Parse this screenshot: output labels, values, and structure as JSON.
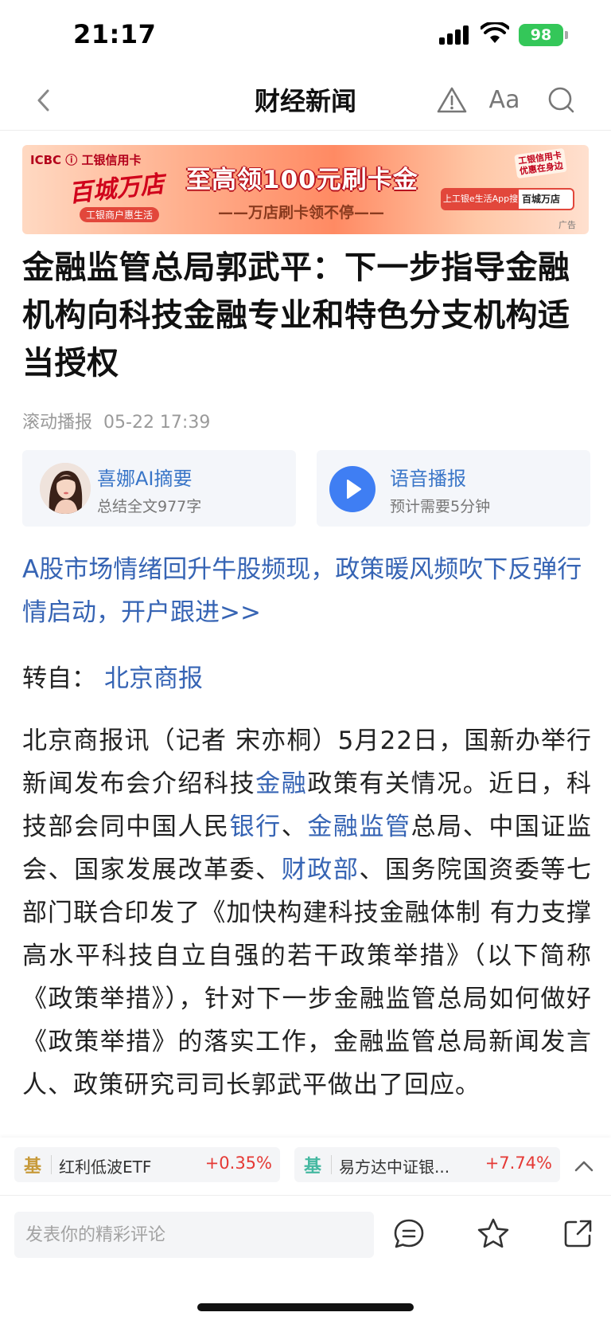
{
  "status_bar": {
    "time": "21:17",
    "battery": "98"
  },
  "nav": {
    "title": "财经新闻",
    "font_label": "Aa"
  },
  "ad": {
    "brand": "ICBC ⓘ 工银信用卡",
    "logo_text": "百城万店",
    "merchant_tag": "工银商户惠生活",
    "headline": "至高领100元刷卡金",
    "sub": "——万店刷卡领不停——",
    "search_prefix": "上工银e生活App搜",
    "search_text": "百城万店",
    "corner_line1": "工银信用卡",
    "corner_line2": "优惠在身边",
    "label": "广告"
  },
  "article": {
    "title": "金融监管总局郭武平：下一步指导金融机构向科技金融专业和特色分支机构适当授权",
    "channel": "滚动播报",
    "datetime": "05-22 17:39",
    "promo_link": "A股市场情绪回升牛股频现，政策暖风频吹下反弹行情启动，开户跟进>>",
    "source_prefix": "转自：",
    "source_name": "北京商报",
    "body_segments": [
      {
        "text": "北京商报讯（记者 宋亦桐）5月22日，国新办举行新闻发布会介绍科技",
        "link": false
      },
      {
        "text": "金融",
        "link": true
      },
      {
        "text": "政策有关情况。近日，科技部会同中国人民",
        "link": false
      },
      {
        "text": "银行",
        "link": true
      },
      {
        "text": "、",
        "link": false
      },
      {
        "text": "金融监管",
        "link": true
      },
      {
        "text": "总局、中国证监会、国家发展改革委、",
        "link": false
      },
      {
        "text": "财政部",
        "link": true
      },
      {
        "text": "、国务院国资委等七部门联合印发了《加快构建科技金融体制 有力支撑高水平科技自立自强的若干政策举措》（以下简称《政策举措》），针对下一步金融监管总局如何做好《政策举措》的落实工作，金融监管总局新闻发言人、政策研究司司长郭武平做出了回应。",
        "link": false
      }
    ]
  },
  "ai_card": {
    "title": "喜娜AI摘要",
    "sub": "总结全文977字"
  },
  "audio_card": {
    "title": "语音播报",
    "sub": "预计需要5分钟"
  },
  "funds": [
    {
      "tag": "基",
      "name": "红利低波ETF",
      "change": "+0.35%"
    },
    {
      "tag": "基",
      "name": "易方达中证银...",
      "change": "+7.74%"
    }
  ],
  "bottom": {
    "comment_placeholder": "发表你的精彩评论"
  },
  "colors": {
    "link": "#3664b4",
    "positive": "#e53935",
    "battery": "#34c759",
    "play": "#3f7ef3"
  }
}
